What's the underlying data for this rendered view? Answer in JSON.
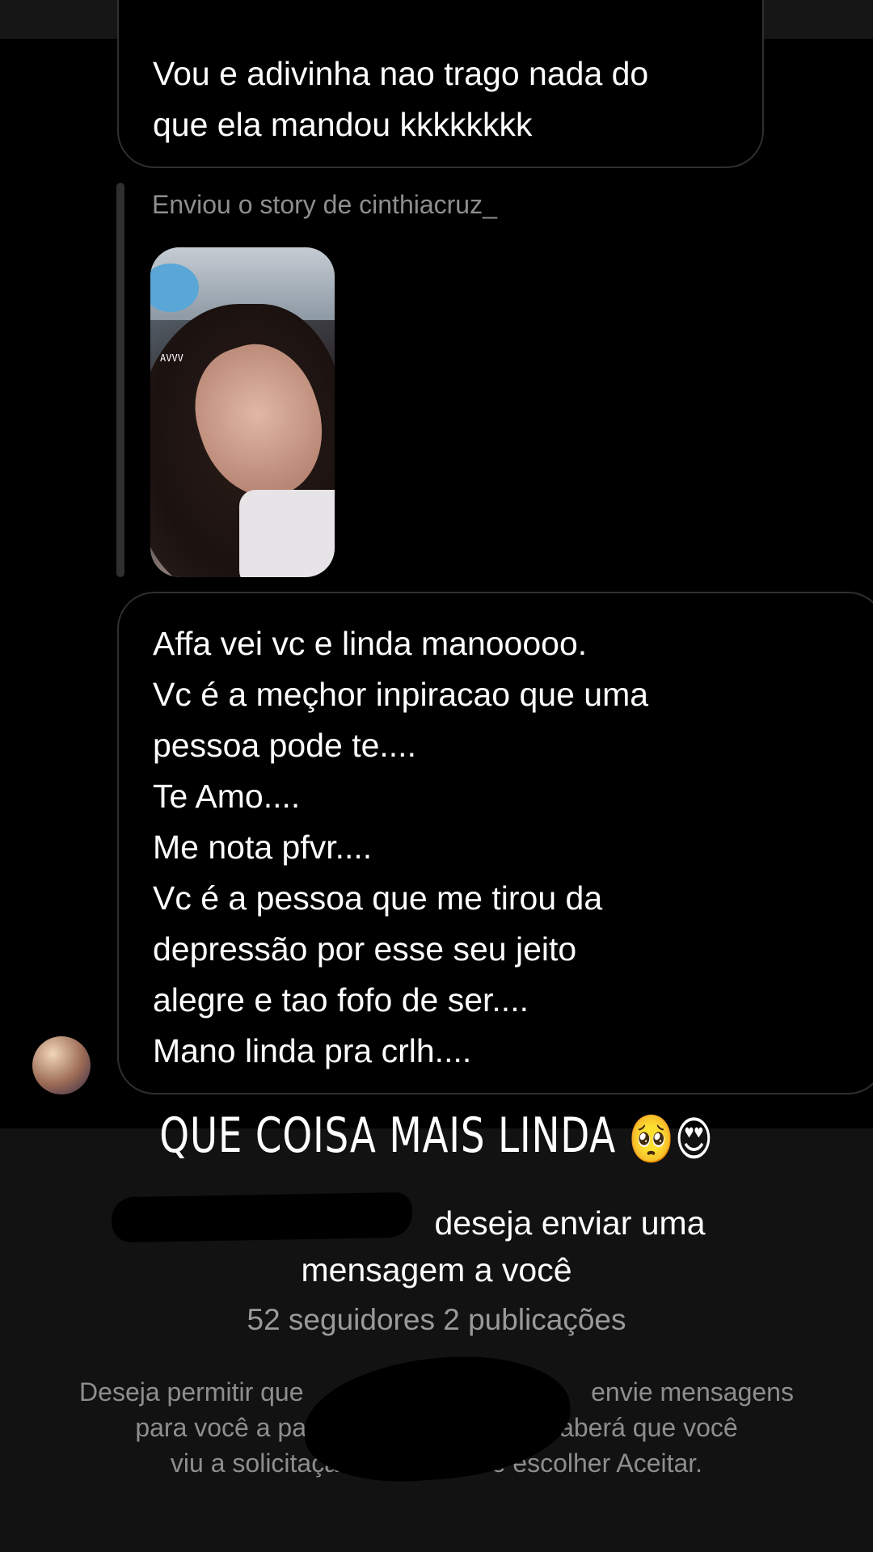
{
  "thread": {
    "message_1": {
      "lines": [
        "Vou e adivinha nao trago nada do",
        "que ela mandou kkkkkkkk"
      ]
    },
    "story_reply": {
      "caption": "Enviou o story de cinthiacruz_",
      "sticker_text": "AVVV"
    },
    "message_2": {
      "lines": [
        "Affa vei vc e linda manooooo.",
        "Vc é a meçhor inpiracao que uma",
        "pessoa pode te....",
        "Te Amo....",
        "Me nota pfvr....",
        "Vc é a pessoa que me tirou da",
        "depressão por esse seu jeito",
        "alegre e tao fofo de ser....",
        "Mano linda pra crlh...."
      ]
    }
  },
  "overlay": {
    "caption": "QUE COISA MAIS LINDA",
    "emojis": [
      "🥺",
      "😍"
    ]
  },
  "request": {
    "title_line_1": "deseja enviar uma",
    "title_line_2": "mensagem a você",
    "counts": "52 seguidores 2 publicações",
    "body_lines": [
      "Deseja permitir que                                        envie mensagens",
      "para você a partir de agora? Ele só saberá que você",
      "viu a solicitação dele se você escolher Aceitar."
    ]
  }
}
